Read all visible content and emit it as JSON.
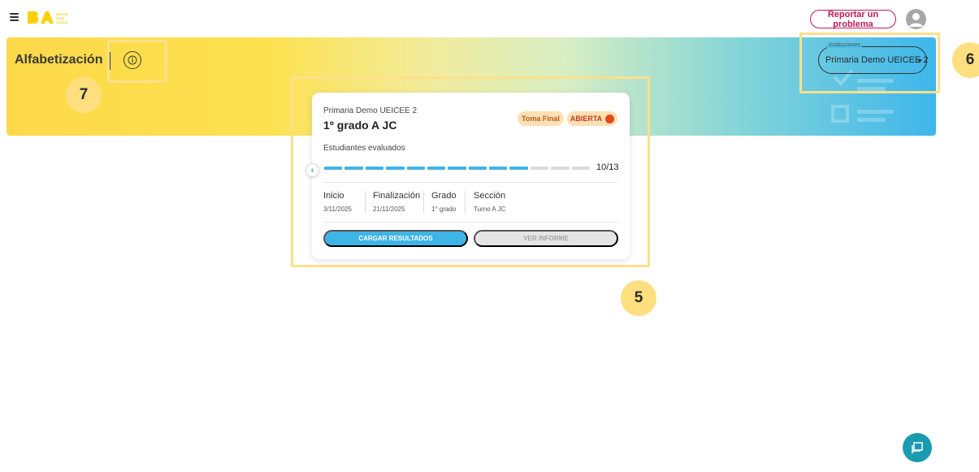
{
  "header": {
    "logo_text": [
      "Buenos",
      "Aires",
      "Ciudad"
    ],
    "report_label": "Reportar un problema"
  },
  "banner": {
    "title": "Alfabetización",
    "institutions_label": "Instituciones",
    "institution_value": "Primaria Demo UEICEE 2"
  },
  "card": {
    "school": "Primaria Demo UEICEE 2",
    "grade_title": "1º grado A JC",
    "tag_final": "Toma Final",
    "tag_status": "ABIERTA",
    "evaluated_label": "Estudiantes evaluados",
    "progress": {
      "done": 10,
      "total": 13,
      "text": "10/13"
    },
    "columns": [
      {
        "header": "Inicio",
        "value": "3/11/2025"
      },
      {
        "header": "Finalización",
        "value": "21/11/2025"
      },
      {
        "header": "Grado",
        "value": "1° grado"
      },
      {
        "header": "Sección",
        "value": "Turno A JC"
      }
    ],
    "load_label": "CARGAR RESULTADOS",
    "report_label": "VER INFORME"
  },
  "annotations": {
    "n5": "5",
    "n6": "6",
    "n7": "7"
  },
  "colors": {
    "accent": "#3fb4e6",
    "brand_pink": "#c2185b",
    "badge": "#fddf7f",
    "progress_empty": "#d9d9d9"
  }
}
